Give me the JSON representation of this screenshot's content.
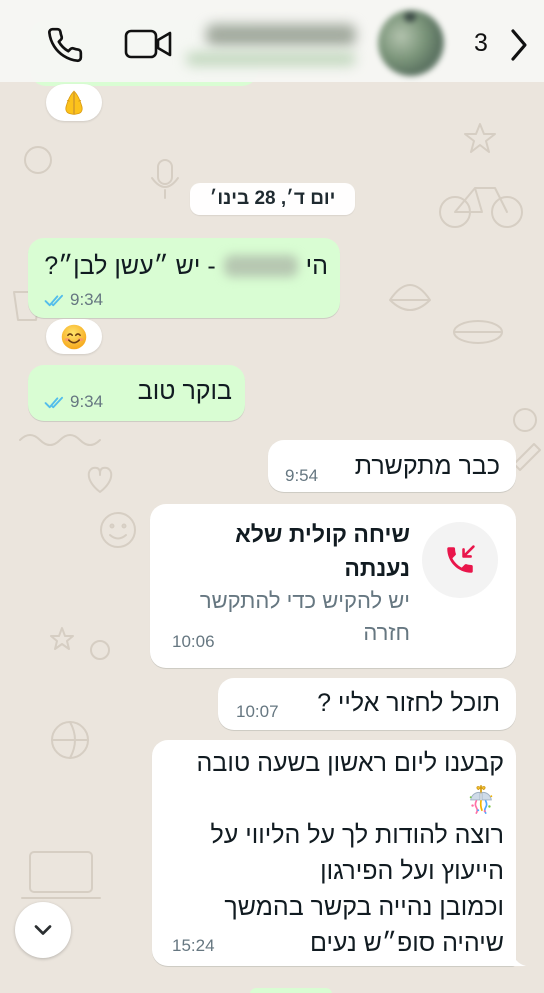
{
  "header": {
    "unread_count": "3",
    "back_icon": "chevron-right-icon",
    "call_icon": "phone-icon",
    "video_icon": "video-camera-icon"
  },
  "chat": {
    "top_reaction_icon": "folded-hands-emoji-icon",
    "date_chip": "יום ד׳, 28 בינו׳",
    "messages": [
      {
        "greeting": "הי",
        "text": "- יש ״עשן לבן״?",
        "time": "9:34",
        "status_icon": "read-double-check-icon",
        "reaction_icon": "smiling-face-emoji-icon"
      },
      {
        "text": "בוקר טוב",
        "time": "9:34",
        "status_icon": "read-double-check-icon"
      },
      {
        "text": "כבר מתקשרת",
        "time": "9:54"
      },
      {
        "icon": "missed-call-icon",
        "title_lines": [
          "שיחה קולית שלא",
          "נענתה"
        ],
        "subtitle_lines": [
          "יש להקיש כדי להתקשר",
          "חזרה"
        ],
        "time": "10:06"
      },
      {
        "text": "תוכל לחזור אליי ?",
        "time": "10:07"
      },
      {
        "lines": [
          "קבענו ליום ראשון בשעה טובה",
          "רוצה להודות לך על הליווי על",
          "הייעוץ ועל הפירגון",
          "וכמובן נהייה בקשר בהמשך",
          "שיהיה סופ״ש נעים"
        ],
        "emoji_icon": "confetti-ball-emoji-icon",
        "time": "15:24"
      }
    ]
  },
  "scroll_button": {
    "icon": "chevron-down-icon"
  },
  "colors": {
    "outgoing_bubble": "#d9fdd3",
    "incoming_bubble": "#ffffff",
    "chat_background": "#ebe5dd",
    "read_ticks": "#53bdeb",
    "missed_call": "#e9164b",
    "timestamp": "#667781"
  }
}
